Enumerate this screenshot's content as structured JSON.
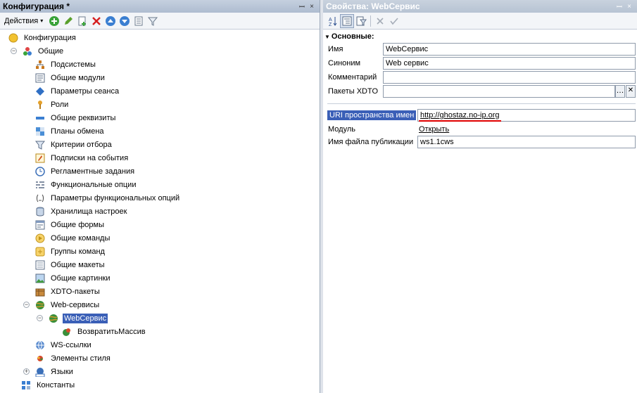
{
  "left_panel": {
    "title": "Конфигурация *",
    "actions_label": "Действия"
  },
  "tree": {
    "root": "Конфигурация",
    "common": "Общие",
    "items": [
      "Подсистемы",
      "Общие модули",
      "Параметры сеанса",
      "Роли",
      "Общие реквизиты",
      "Планы обмена",
      "Критерии отбора",
      "Подписки на события",
      "Регламентные задания",
      "Функциональные опции",
      "Параметры функциональных опций",
      "Хранилища настроек",
      "Общие формы",
      "Общие команды",
      "Группы команд",
      "Общие макеты",
      "Общие картинки",
      "XDTO-пакеты"
    ],
    "web_services": "Web-сервисы",
    "web_service": "WebСервис",
    "operation": "ВозвратитьМассив",
    "ws_links": "WS-ссылки",
    "style_items": "Элементы стиля",
    "languages": "Языки",
    "constants": "Константы"
  },
  "right_panel": {
    "title": "Свойства: WebСервис",
    "section": "Основные:",
    "name_label": "Имя",
    "name_value": "WebСервис",
    "synonym_label": "Синоним",
    "synonym_value": "Web сервис",
    "comment_label": "Комментарий",
    "comment_value": "",
    "xdto_label": "Пакеты XDTO",
    "xdto_value": "",
    "uri_label": "URI пространства имен",
    "uri_value": "http://ghostaz.no-ip.org",
    "module_label": "Модуль",
    "module_link": "Открыть",
    "pubfile_label": "Имя файла публикации",
    "pubfile_value": "ws1.1cws"
  },
  "colors": {
    "selection": "#3a5fb7",
    "underline": "#e00000"
  }
}
